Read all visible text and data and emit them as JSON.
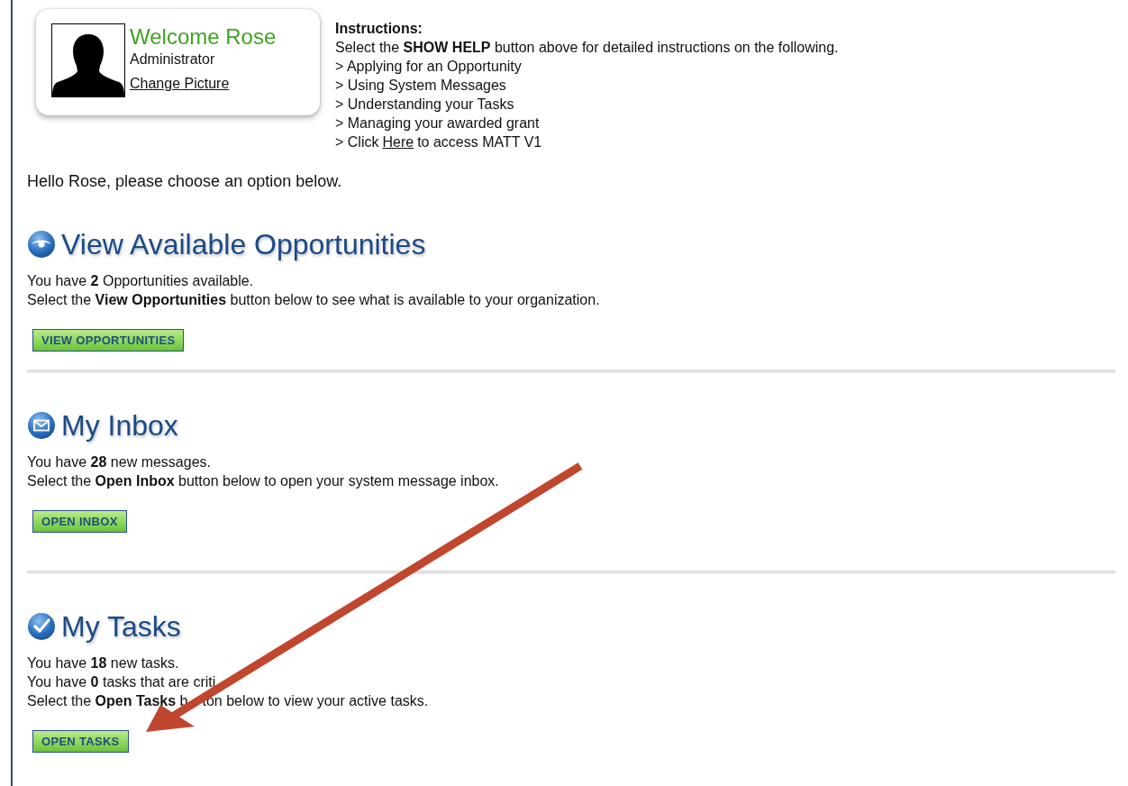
{
  "profile": {
    "welcome": "Welcome Rose",
    "role": "Administrator",
    "change_picture": "Change Picture"
  },
  "instructions": {
    "title": "Instructions:",
    "intro": "Select the **SHOW HELP** button above for detailed instructions on the following.",
    "items": [
      "> Applying for an Opportunity",
      "> Using System Messages",
      "> Understanding your Tasks",
      "> Managing your awarded grant"
    ],
    "link_item": {
      "before": "> Click",
      "link": "Here",
      "after": "to access MATT V1"
    }
  },
  "greeting": "Hello Rose, please choose an option below.",
  "sections": [
    {
      "kind": "eye",
      "title": "View Available Opportunities",
      "lines": [
        "You have **2** Opportunities available.",
        "Select the **View Opportunities** button below to see what is available to your organization."
      ],
      "button": "VIEW OPPORTUNITIES"
    },
    {
      "kind": "mail",
      "title": "My Inbox",
      "lines": [
        "You have **28** new messages.",
        "Select the **Open Inbox** button below to open your system message inbox."
      ],
      "button": "OPEN INBOX"
    },
    {
      "kind": "check",
      "title": "My Tasks",
      "lines": [
        "You have **18** new tasks.",
        "You have **0** tasks that are criti",
        {
          "before": "Select the **Open Tasks** b",
          "after": "ton below to view your active tasks."
        }
      ],
      "button": "OPEN TASKS"
    }
  ]
}
